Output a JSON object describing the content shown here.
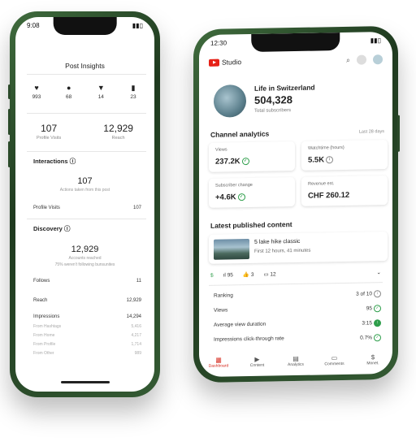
{
  "left_phone": {
    "status_time": "9:08",
    "title": "Post Insights",
    "top_stats": [
      {
        "icon": "heart-icon",
        "glyph": "♥",
        "value": "993"
      },
      {
        "icon": "comment-icon",
        "glyph": "●",
        "value": "68"
      },
      {
        "icon": "share-icon",
        "glyph": "▼",
        "value": "14"
      },
      {
        "icon": "save-icon",
        "glyph": "▮",
        "value": "23"
      }
    ],
    "profile_visits_value": "107",
    "profile_visits_label": "Profile Visits",
    "reach_value": "12,929",
    "reach_label": "Reach",
    "interactions_title": "Interactions ⓘ",
    "interactions_value": "107",
    "interactions_caption": "Actions taken from this post",
    "profile_visits_row_label": "Profile Visits",
    "profile_visits_row_value": "107",
    "discovery_title": "Discovery ⓘ",
    "discovery_value": "12,929",
    "discovery_caption": "Accounts reached",
    "discovery_caption2": "75% weren't following bunsunites",
    "follows_label": "Follows",
    "follows_value": "11",
    "reach_row_label": "Reach",
    "reach_row_value": "12,929",
    "impressions_label": "Impressions",
    "impressions_value": "14,294",
    "sub_rows": [
      {
        "label": "From Hashtags",
        "value": "5,416"
      },
      {
        "label": "From Home",
        "value": "4,217"
      },
      {
        "label": "From Profile",
        "value": "1,714"
      },
      {
        "label": "From Other",
        "value": "989"
      }
    ]
  },
  "right_phone": {
    "status_time": "12:30",
    "logo_text": "Studio",
    "channel_name": "Life in Switzerland",
    "subscribers": "504,328",
    "subscribers_label": "Total subscribers",
    "analytics_title": "Channel analytics",
    "analytics_period": "Last 28 days",
    "cards": [
      {
        "label": "Views",
        "value": "237.2K"
      },
      {
        "label": "Watchtime (hours)",
        "value": "5.5K"
      },
      {
        "label": "Subscriber change",
        "value": "+4.6K"
      },
      {
        "label": "Revenue est.",
        "value": "CHF 260.12"
      }
    ],
    "latest_title": "Latest published content",
    "video_title": "5 lake hike classic",
    "video_meta": "First 12 hours, 41 minutes",
    "video_metrics": [
      {
        "icon": "dollar-icon",
        "glyph": "$",
        "value": ""
      },
      {
        "icon": "bars-icon",
        "glyph": "ıl",
        "value": "95"
      },
      {
        "icon": "like-icon",
        "glyph": "👍",
        "value": "3"
      },
      {
        "icon": "comment-icon",
        "glyph": "▭",
        "value": "12"
      }
    ],
    "ranking_label": "Ranking",
    "ranking_value": "3 of 10",
    "views_label": "Views",
    "views_value": "95",
    "avd_label": "Average view duration",
    "avd_value": "3:15",
    "ctr_label": "Impressions click-through rate",
    "ctr_value": "0.7%",
    "tabs": [
      {
        "label": "Dashboard",
        "icon": "dashboard-icon",
        "glyph": "▦"
      },
      {
        "label": "Content",
        "icon": "content-icon",
        "glyph": "▶"
      },
      {
        "label": "Analytics",
        "icon": "analytics-icon",
        "glyph": "▤"
      },
      {
        "label": "Comments",
        "icon": "comments-icon",
        "glyph": "▭"
      },
      {
        "label": "Monet.",
        "icon": "dollar-icon",
        "glyph": "$"
      }
    ]
  }
}
